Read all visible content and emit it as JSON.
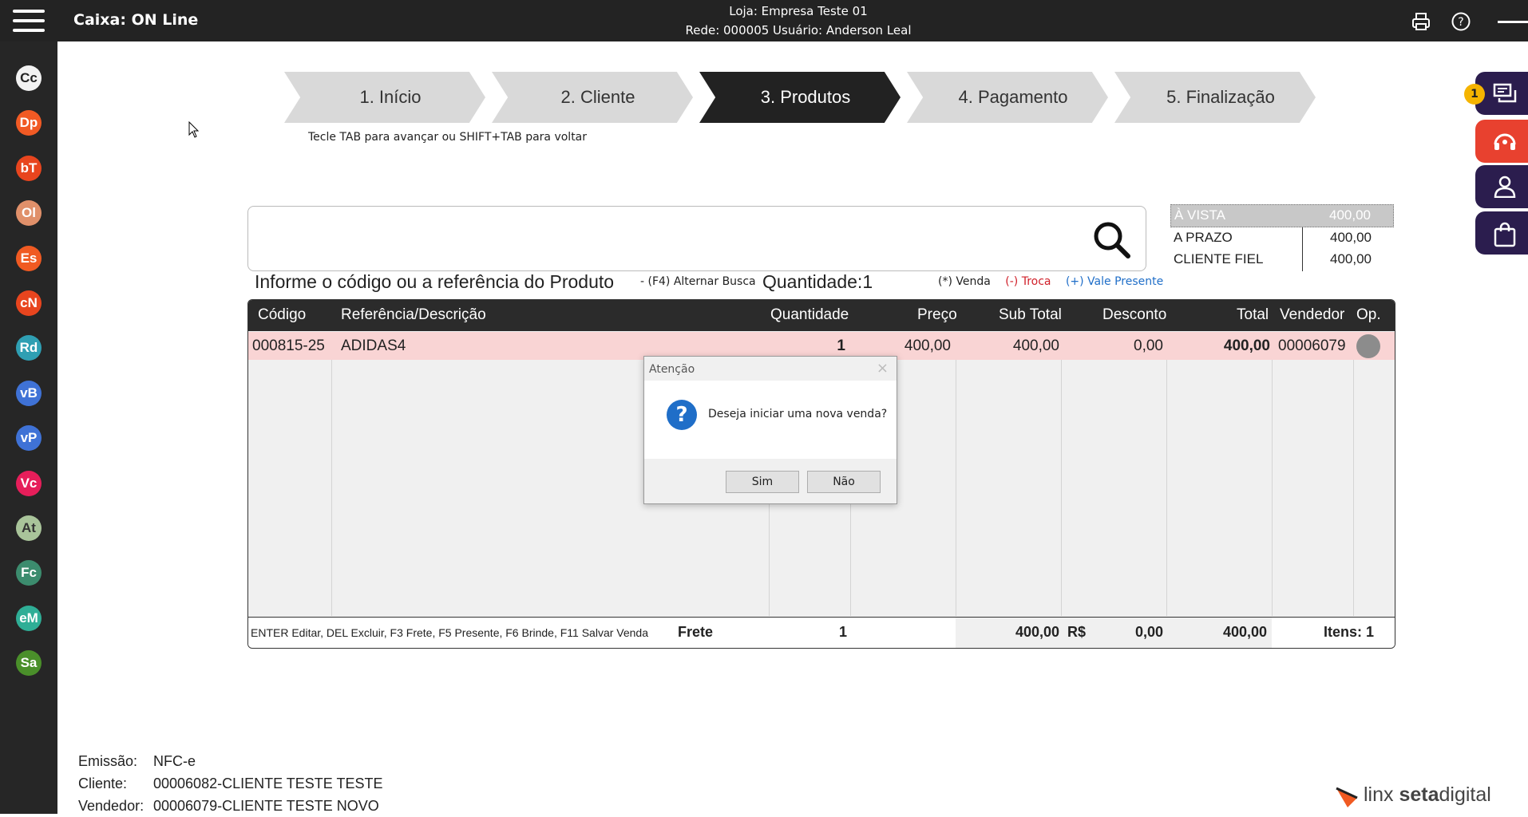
{
  "header": {
    "app_title": "Caixa: ON Line",
    "store_line": "Loja: Empresa Teste  01",
    "network_line": "Rede: 000005 Usuário: Anderson Leal"
  },
  "sidebar": {
    "items": [
      {
        "label": "Cc",
        "color": "#f2f2f2",
        "text_color": "#222222"
      },
      {
        "label": "Dp",
        "color": "#f15a24"
      },
      {
        "label": "bT",
        "color": "#e8451e"
      },
      {
        "label": "Ol",
        "color": "#e0906a"
      },
      {
        "label": "Es",
        "color": "#f05a22"
      },
      {
        "label": "cN",
        "color": "#e8451e"
      },
      {
        "label": "Rd",
        "color": "#2f9fb3"
      },
      {
        "label": "vB",
        "color": "#3f72d6"
      },
      {
        "label": "vP",
        "color": "#3f72d6"
      },
      {
        "label": "Vc",
        "color": "#e61e5a"
      },
      {
        "label": "At",
        "color": "#a9c49a",
        "text_color": "#333333"
      },
      {
        "label": "Fc",
        "color": "#3c8c6e"
      },
      {
        "label": "eM",
        "color": "#2fae96"
      },
      {
        "label": "Sa",
        "color": "#4a8f2a"
      }
    ]
  },
  "steps": [
    {
      "label": "1. Início",
      "active": false
    },
    {
      "label": "2. Cliente",
      "active": false
    },
    {
      "label": "3. Produtos",
      "active": true
    },
    {
      "label": "4. Pagamento",
      "active": false
    },
    {
      "label": "5. Finalização",
      "active": false
    }
  ],
  "tab_hint": "Tecle TAB para avançar ou SHIFT+TAB para voltar",
  "search": {
    "value": "",
    "hint": "Informe o código ou a referência do Produto",
    "alt_search": "- (F4) Alternar Busca",
    "quantity_label": "Quantidade:",
    "quantity_value": "1",
    "legend": {
      "venda": "(*) Venda",
      "troca": "(-) Troca",
      "vale": "(+) Vale Presente"
    }
  },
  "prices": [
    {
      "label": "À VISTA",
      "value": "400,00",
      "selected": true
    },
    {
      "label": "A PRAZO",
      "value": "400,00",
      "selected": false
    },
    {
      "label": "CLIENTE FIEL",
      "value": "400,00",
      "selected": false
    }
  ],
  "grid": {
    "headers": {
      "codigo": "Código",
      "referencia": "Referência/Descrição",
      "quantidade": "Quantidade",
      "preco": "Preço",
      "subtotal": "Sub Total",
      "desconto": "Desconto",
      "total": "Total",
      "vendedor": "Vendedor",
      "op": "Op."
    },
    "rows": [
      {
        "codigo": "000815-25",
        "referencia": "ADIDAS4",
        "quantidade": "1",
        "preco": "400,00",
        "subtotal": "400,00",
        "desconto": "0,00",
        "total": "400,00",
        "vendedor": "00006079"
      }
    ],
    "totals": {
      "shortcuts": "ENTER Editar, DEL Excluir, F3 Frete, F5 Presente, F6 Brinde, F11 Salvar Venda",
      "frete_label": "Frete",
      "quantidade": "1",
      "subtotal": "400,00",
      "currency": "R$",
      "desconto": "0,00",
      "total": "400,00",
      "itens": "Itens: 1"
    }
  },
  "dialog": {
    "title": "Atenção",
    "close": "×",
    "icon": "?",
    "message": "Deseja iniciar uma nova venda?",
    "yes": "Sim",
    "no": "Não"
  },
  "notifications_count": "1",
  "footer": {
    "emissao_label": "Emissão:",
    "emissao_value": "NFC-e",
    "cliente_label": "Cliente:",
    "cliente_value": "00006082-CLIENTE TESTE TESTE",
    "vendedor_label": "Vendedor:",
    "vendedor_value": "00006079-CLIENTE TESTE NOVO"
  },
  "brand": {
    "prefix": "linx ",
    "bold": "seta",
    "suffix": "digital"
  },
  "colors": {
    "accent_dark": "#2b1d4e",
    "accent_red": "#e8412f",
    "row_highlight": "#f9d4d4",
    "troca": "#d0202a",
    "vale": "#1f6ec8"
  },
  "icons": [
    "menu-icon",
    "printer-icon",
    "help-icon",
    "minimize-icon",
    "search-icon",
    "chat-icon",
    "support-icon",
    "user-icon",
    "bag-icon",
    "question-icon",
    "brand-logo-icon",
    "cursor-icon"
  ]
}
